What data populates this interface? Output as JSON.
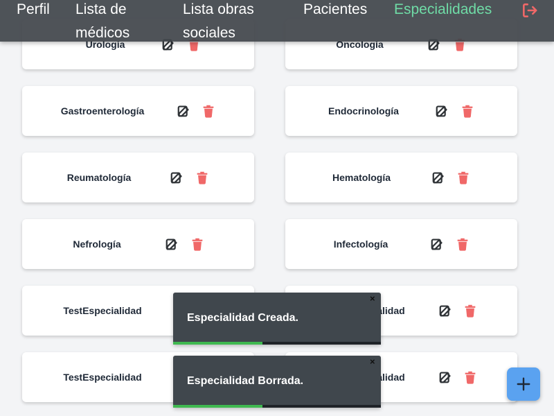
{
  "nav": {
    "items": [
      {
        "label": "Perfil",
        "active": false
      },
      {
        "label": "Lista de médicos",
        "active": false
      },
      {
        "label": "Lista obras sociales",
        "active": false
      },
      {
        "label": "Pacientes",
        "active": false
      },
      {
        "label": "Especialidades",
        "active": true
      }
    ],
    "logout_icon": "logout-icon",
    "active_color": "#6fdba6"
  },
  "specialties": [
    {
      "name": "Urología"
    },
    {
      "name": "Oncología"
    },
    {
      "name": "Gastroenterología"
    },
    {
      "name": "Endocrinología"
    },
    {
      "name": "Reumatología"
    },
    {
      "name": "Hematología"
    },
    {
      "name": "Nefrología"
    },
    {
      "name": "Infectología"
    },
    {
      "name": "TestEspecialidad"
    },
    {
      "name": "TestEspecialidad"
    },
    {
      "name": "TestEspecialidad"
    },
    {
      "name": "TestEspecialidad"
    }
  ],
  "card_icons": {
    "edit": "edit-icon",
    "delete": "trash-icon"
  },
  "colors": {
    "edit": "#2f3337",
    "delete": "#f06868",
    "fab": "#5aa2f0"
  },
  "toasts": [
    {
      "message": "Especialidad Creada.",
      "close": "×",
      "progress": 0.43
    },
    {
      "message": "Especialidad Borrada.",
      "close": "×",
      "progress": 0.43
    }
  ],
  "fab": {
    "icon": "plus-icon"
  }
}
